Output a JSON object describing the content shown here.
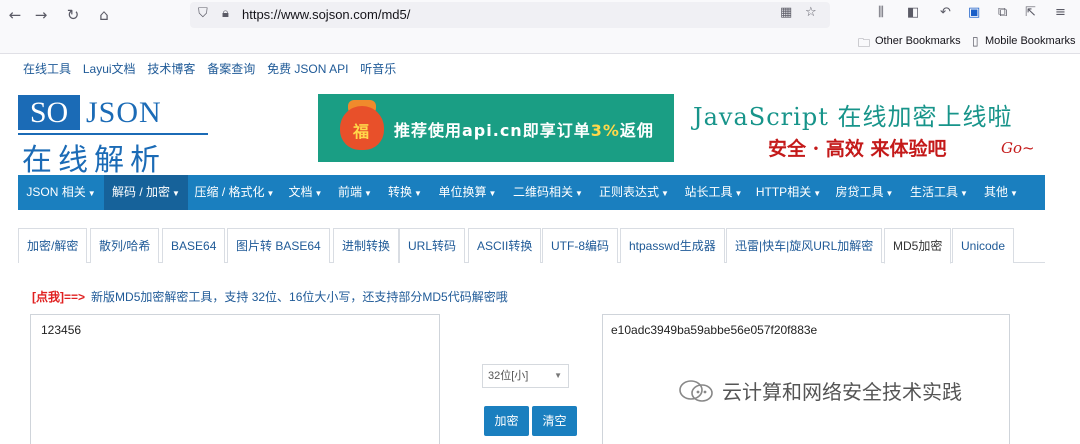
{
  "browser": {
    "url": "https://www.sojson.com/md5/",
    "bookmarks": {
      "other": "Other Bookmarks",
      "mobile": "Mobile Bookmarks"
    }
  },
  "site": {
    "top_links": [
      "在线工具",
      "Layui文档",
      "技术博客",
      "备案查询",
      "免费 JSON API",
      "听音乐"
    ],
    "logo": {
      "so": "SO",
      "json": "JSON",
      "cn": "在线解析"
    },
    "banner": {
      "bag_char": "福",
      "text_pre": "推荐使用api.cn即享订单",
      "text_hl": "3%",
      "text_post": "返佣"
    },
    "promo": {
      "title": "JavaScript 在线加密上线啦",
      "subtitle": "安全 · 高效  来体验吧",
      "go": "Go~"
    },
    "main_nav": [
      {
        "label": "JSON 相关"
      },
      {
        "label": "解码 / 加密"
      },
      {
        "label": "压缩 / 格式化"
      },
      {
        "label": "文档"
      },
      {
        "label": "前端"
      },
      {
        "label": "转换"
      },
      {
        "label": "单位换算"
      },
      {
        "label": "二维码相关"
      },
      {
        "label": "正则表达式"
      },
      {
        "label": "站长工具"
      },
      {
        "label": "HTTP相关"
      },
      {
        "label": "房贷工具"
      },
      {
        "label": "生活工具"
      },
      {
        "label": "其他"
      }
    ],
    "sub_tabs": [
      "加密/解密",
      "散列/哈希",
      "BASE64",
      "图片转 BASE64",
      "进制转换",
      "URL转码",
      "ASCII转换",
      "UTF-8编码",
      "htpasswd生成器",
      "迅雷|快车|旋风URL加解密",
      "MD5加密",
      "Unicode"
    ],
    "notice": {
      "tag": "[点我]",
      "arrow": "==>",
      "text": "新版MD5加密解密工具，支持 32位、16位大小写，还支持部分MD5代码解密哦"
    },
    "input_text": "123456",
    "output_text": "e10adc3949ba59abbe56e057f20f883e",
    "mode_select": "32位[小]",
    "encrypt_label": "加密",
    "clear_label": "清空",
    "watermark": "云计算和网络安全技术实践"
  },
  "colors": {
    "nav_blue": "#1a7fbf",
    "nav_active": "#16629a",
    "banner_green": "#1a9e84",
    "promo_teal": "#17948a",
    "promo_red": "#c41a1a"
  }
}
